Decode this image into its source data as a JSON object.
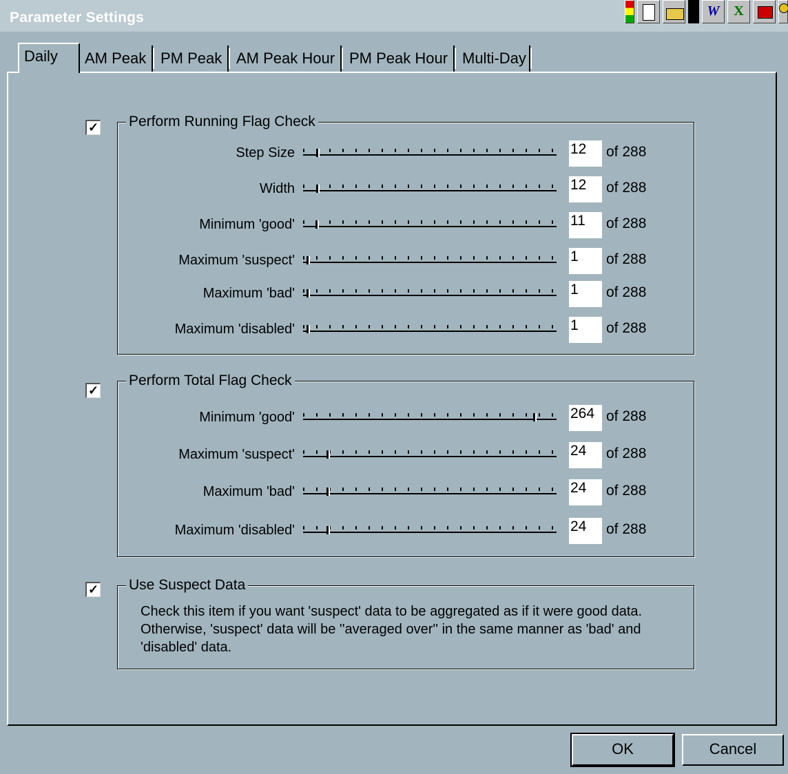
{
  "window": {
    "title": "Parameter Settings"
  },
  "toolbar_icons": [
    "color-palette-icon",
    "notepad-icon",
    "open-folder-icon",
    "word-icon",
    "excel-icon",
    "powerpoint-icon",
    "key-icon"
  ],
  "tabs": [
    "Daily",
    "AM Peak",
    "PM Peak",
    "AM Peak Hour",
    "PM Peak Hour",
    "Multi-Day"
  ],
  "running_check": {
    "label": "Perform Running Flag Check",
    "checked": true,
    "rows": [
      {
        "label": "Step Size",
        "value": "12",
        "of": "of  288",
        "fraction": 0.042
      },
      {
        "label": "Width",
        "value": "12",
        "of": "of  288",
        "fraction": 0.042
      },
      {
        "label": "Minimum 'good'",
        "value": "11",
        "of": "of  288",
        "fraction": 0.038
      },
      {
        "label": "Maximum 'suspect'",
        "value": "1",
        "of": "of  288",
        "fraction": 0.003
      },
      {
        "label": "Maximum 'bad'",
        "value": "1",
        "of": "of  288",
        "fraction": 0.003
      },
      {
        "label": "Maximum 'disabled'",
        "value": "1",
        "of": "of  288",
        "fraction": 0.003
      }
    ]
  },
  "total_check": {
    "label": "Perform Total Flag Check",
    "checked": true,
    "rows": [
      {
        "label": "Minimum 'good'",
        "value": "264",
        "of": "of  288",
        "fraction": 0.917
      },
      {
        "label": "Maximum 'suspect'",
        "value": "24",
        "of": "of  288",
        "fraction": 0.083
      },
      {
        "label": "Maximum 'bad'",
        "value": "24",
        "of": "of  288",
        "fraction": 0.083
      },
      {
        "label": "Maximum 'disabled'",
        "value": "24",
        "of": "of  288",
        "fraction": 0.083
      }
    ]
  },
  "suspect_data": {
    "label": "Use Suspect Data",
    "checked": true,
    "description_lines": [
      "Check this item if you want 'suspect' data to be aggregated as if it were good data.",
      "Otherwise, 'suspect' data will be ''averaged over'' in the same manner as 'bad' and",
      "'disabled' data."
    ]
  },
  "buttons": {
    "ok": "OK",
    "cancel": "Cancel"
  }
}
